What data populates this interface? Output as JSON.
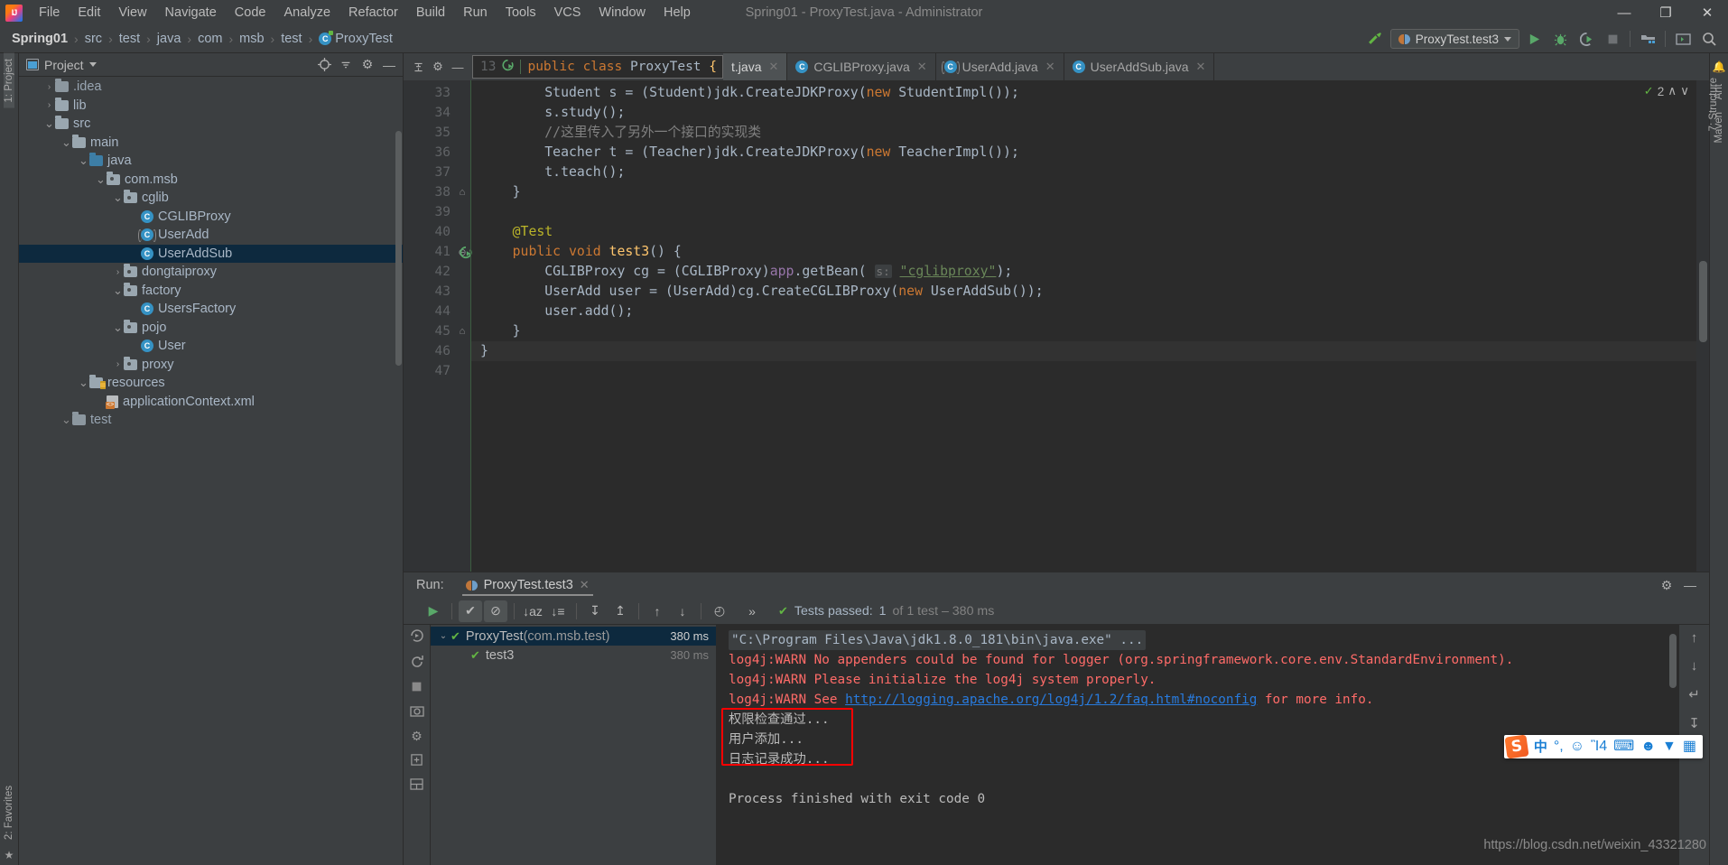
{
  "window": {
    "title": "Spring01 - ProxyTest.java - Administrator",
    "minimize": "—",
    "maximize": "❐",
    "close": "✕"
  },
  "menubar": [
    {
      "label": "File"
    },
    {
      "label": "Edit"
    },
    {
      "label": "View"
    },
    {
      "label": "Navigate"
    },
    {
      "label": "Code"
    },
    {
      "label": "Analyze"
    },
    {
      "label": "Refactor"
    },
    {
      "label": "Build"
    },
    {
      "label": "Run"
    },
    {
      "label": "Tools"
    },
    {
      "label": "VCS"
    },
    {
      "label": "Window"
    },
    {
      "label": "Help"
    }
  ],
  "breadcrumbs": [
    {
      "label": "Spring01",
      "bold": true
    },
    {
      "label": "src"
    },
    {
      "label": "test"
    },
    {
      "label": "java"
    },
    {
      "label": "com"
    },
    {
      "label": "msb"
    },
    {
      "label": "test"
    },
    {
      "label": "ProxyTest",
      "icon": "class-icon"
    }
  ],
  "breadcrumb_separator": "›",
  "toolbar": {
    "build_label": "build-hammer-icon",
    "run_config": "ProxyTest.test3",
    "run_label": "run-icon",
    "debug_label": "debug-icon",
    "coverage_label": "run-with-coverage-icon",
    "stop_label": "stop-icon",
    "project_structure_label": "project-structure-icon",
    "terminal_label": "terminal-icon",
    "search_label": "search-everywhere-icon"
  },
  "sidebar": {
    "title": "Project",
    "rail_left": [
      "1: Project",
      "2: Favorites"
    ],
    "rail_right": [
      "Ant",
      "Maven",
      "7: Structure"
    ],
    "tree": [
      {
        "label": ".idea",
        "depth": 1,
        "arrow": "›",
        "icon": "folder",
        "clipped": true
      },
      {
        "label": "lib",
        "depth": 1,
        "arrow": "›",
        "icon": "folder"
      },
      {
        "label": "src",
        "depth": 1,
        "arrow": "⌄",
        "icon": "folder"
      },
      {
        "label": "main",
        "depth": 2,
        "arrow": "⌄",
        "icon": "folder"
      },
      {
        "label": "java",
        "depth": 3,
        "arrow": "⌄",
        "icon": "folder-blue"
      },
      {
        "label": "com.msb",
        "depth": 4,
        "arrow": "⌄",
        "icon": "folder-package"
      },
      {
        "label": "cglib",
        "depth": 5,
        "arrow": "⌄",
        "icon": "folder-package"
      },
      {
        "label": "CGLIBProxy",
        "depth": 6,
        "arrow": "",
        "icon": "class-icon"
      },
      {
        "label": "UserAdd",
        "depth": 6,
        "arrow": "",
        "icon": "interface-icon"
      },
      {
        "label": "UserAddSub",
        "depth": 6,
        "arrow": "",
        "icon": "class-icon",
        "selected": true
      },
      {
        "label": "dongtaiproxy",
        "depth": 5,
        "arrow": "›",
        "icon": "folder-package"
      },
      {
        "label": "factory",
        "depth": 5,
        "arrow": "⌄",
        "icon": "folder-package"
      },
      {
        "label": "UsersFactory",
        "depth": 6,
        "arrow": "",
        "icon": "class-icon"
      },
      {
        "label": "pojo",
        "depth": 5,
        "arrow": "⌄",
        "icon": "folder-package"
      },
      {
        "label": "User",
        "depth": 6,
        "arrow": "",
        "icon": "class-icon"
      },
      {
        "label": "proxy",
        "depth": 5,
        "arrow": "›",
        "icon": "folder-package"
      },
      {
        "label": "resources",
        "depth": 3,
        "arrow": "⌄",
        "icon": "folder-resources"
      },
      {
        "label": "applicationContext.xml",
        "depth": 4,
        "arrow": "",
        "icon": "xml-icon"
      },
      {
        "label": "test",
        "depth": 2,
        "arrow": "⌄",
        "icon": "folder",
        "clipped": true
      }
    ]
  },
  "editor": {
    "tabs": [
      {
        "label": "t.java",
        "icon": "",
        "active": true,
        "close": "✕"
      },
      {
        "label": "CGLIBProxy.java",
        "icon": "class-icon",
        "active": false,
        "close": "✕"
      },
      {
        "label": "UserAdd.java",
        "icon": "interface-icon",
        "active": false,
        "close": "✕"
      },
      {
        "label": "UserAddSub.java",
        "icon": "class-icon",
        "active": false,
        "close": "✕"
      }
    ],
    "sticky_header": {
      "line": "13",
      "text": "public class ProxyTest {",
      "gutter_icon": "run-test-icon"
    },
    "inspection": {
      "count": "2",
      "up": "∧",
      "down": "∨"
    },
    "lines": [
      {
        "n": "33",
        "fold": "",
        "tokens": [
          {
            "t": "        Student s = (Student)jdk.CreateJDKProxy(",
            "c": "plain"
          },
          {
            "t": "new",
            "c": "kw"
          },
          {
            "t": " StudentImpl());",
            "c": "plain"
          }
        ]
      },
      {
        "n": "34",
        "fold": "",
        "tokens": [
          {
            "t": "        s.study();",
            "c": "plain"
          }
        ]
      },
      {
        "n": "35",
        "fold": "",
        "tokens": [
          {
            "t": "        //这里传入了另外一个接口的实现类",
            "c": "cmt"
          }
        ]
      },
      {
        "n": "36",
        "fold": "",
        "tokens": [
          {
            "t": "        Teacher t = (Teacher)jdk.CreateJDKProxy(",
            "c": "plain"
          },
          {
            "t": "new",
            "c": "kw"
          },
          {
            "t": " TeacherImpl());",
            "c": "plain"
          }
        ]
      },
      {
        "n": "37",
        "fold": "",
        "tokens": [
          {
            "t": "        t.teach();",
            "c": "plain"
          }
        ]
      },
      {
        "n": "38",
        "fold": "⌂",
        "tokens": [
          {
            "t": "    }",
            "c": "plain"
          }
        ]
      },
      {
        "n": "39",
        "fold": "",
        "tokens": [
          {
            "t": "",
            "c": "plain"
          }
        ]
      },
      {
        "n": "40",
        "fold": "",
        "tokens": [
          {
            "t": "    @Test",
            "c": "ann"
          }
        ]
      },
      {
        "n": "41",
        "fold": "⊖",
        "run": true,
        "tokens": [
          {
            "t": "    ",
            "c": "plain"
          },
          {
            "t": "public void",
            "c": "kw"
          },
          {
            "t": " ",
            "c": "plain"
          },
          {
            "t": "test3",
            "c": "mth"
          },
          {
            "t": "() {",
            "c": "plain"
          }
        ]
      },
      {
        "n": "42",
        "fold": "",
        "tokens": [
          {
            "t": "        CGLIBProxy cg = (CGLIBProxy)",
            "c": "plain"
          },
          {
            "t": "app",
            "c": "fld"
          },
          {
            "t": ".getBean( ",
            "c": "plain"
          },
          {
            "t": "s:",
            "c": "hint"
          },
          {
            "t": " ",
            "c": "plain"
          },
          {
            "t": "\"cglibproxy\"",
            "c": "str-under"
          },
          {
            "t": ");",
            "c": "plain"
          }
        ]
      },
      {
        "n": "43",
        "fold": "",
        "tokens": [
          {
            "t": "        UserAdd user = (UserAdd)cg.CreateCGLIBProxy(",
            "c": "plain"
          },
          {
            "t": "new",
            "c": "kw"
          },
          {
            "t": " UserAddSub());",
            "c": "plain"
          }
        ]
      },
      {
        "n": "44",
        "fold": "",
        "tokens": [
          {
            "t": "        user.add();",
            "c": "plain"
          }
        ]
      },
      {
        "n": "45",
        "fold": "⌂",
        "tokens": [
          {
            "t": "    }",
            "c": "plain"
          }
        ]
      },
      {
        "n": "46",
        "fold": "",
        "caret": true,
        "tokens": [
          {
            "t": "}",
            "c": "plain"
          }
        ]
      },
      {
        "n": "47",
        "fold": "",
        "tokens": [
          {
            "t": "",
            "c": "plain"
          }
        ]
      }
    ]
  },
  "run_panel": {
    "label": "Run:",
    "tab": "ProxyTest.test3",
    "tab_close": "✕",
    "settings_icon": "gear-icon",
    "hide_icon": "—",
    "toolbar": [
      {
        "name": "rerun-icon",
        "glyph": "▶"
      },
      {
        "name": "show-passed-icon",
        "glyph": "✔",
        "toggled": true
      },
      {
        "name": "hide-ignored-icon",
        "glyph": "⊘",
        "toggled": true
      },
      {
        "name": "sort-alphabetically-icon",
        "glyph": "↓aᴢ"
      },
      {
        "name": "sort-by-duration-icon",
        "glyph": "↓≡"
      },
      {
        "name": "expand-all-icon",
        "glyph": "↧"
      },
      {
        "name": "collapse-all-icon",
        "glyph": "↥"
      },
      {
        "name": "prev-failed-icon",
        "glyph": "↑"
      },
      {
        "name": "next-failed-icon",
        "glyph": "↓"
      },
      {
        "name": "test-history-icon",
        "glyph": "◴"
      }
    ],
    "overflow": "»",
    "status": {
      "check": "✔",
      "label": "Tests passed:",
      "count": "1",
      "detail": "of 1 test – 380 ms"
    },
    "tests": [
      {
        "name": "ProxyTest",
        "pkg": "(com.msb.test)",
        "duration": "380 ms",
        "depth": 0,
        "arrow": "⌄",
        "selected": true
      },
      {
        "name": "test3",
        "pkg": "",
        "duration": "380 ms",
        "depth": 1,
        "arrow": "",
        "selected": false
      }
    ],
    "console": [
      {
        "text": "\"C:\\Program Files\\Java\\jdk1.8.0_181\\bin\\java.exe\" ...",
        "style": "cmd"
      },
      {
        "text": "log4j:WARN No appenders could be found for logger (org.springframework.core.env.StandardEnvironment).",
        "style": "err"
      },
      {
        "text": "log4j:WARN Please initialize the log4j system properly.",
        "style": "err"
      },
      {
        "text": "log4j:WARN See ",
        "style": "err",
        "link": "http://logging.apache.org/log4j/1.2/faq.html#noconfig",
        "suffix": " for more info."
      },
      {
        "text": "权限检查通过...",
        "style": "out"
      },
      {
        "text": "用户添加...",
        "style": "out"
      },
      {
        "text": "日志记录成功...",
        "style": "out"
      },
      {
        "text": "",
        "style": "out"
      },
      {
        "text": "Process finished with exit code 0",
        "style": "out"
      }
    ],
    "console_rail": [
      {
        "name": "scroll-up-icon",
        "glyph": "↑"
      },
      {
        "name": "scroll-down-icon",
        "glyph": "↓"
      },
      {
        "name": "soft-wrap-icon",
        "glyph": "↵"
      },
      {
        "name": "scroll-to-end-icon",
        "glyph": "↧"
      },
      {
        "name": "print-icon",
        "glyph": "⎙"
      }
    ]
  },
  "ime": {
    "logo": "S",
    "items": [
      {
        "name": "chinese-mode-icon",
        "glyph": "中"
      },
      {
        "name": "punctuation-icon",
        "glyph": "°,"
      },
      {
        "name": "emoji-icon",
        "glyph": "☺"
      },
      {
        "name": "voice-input-icon",
        "glyph": "Ἲ4"
      },
      {
        "name": "keyboard-icon",
        "glyph": "⌨"
      },
      {
        "name": "user-icon",
        "glyph": "☻"
      },
      {
        "name": "skin-icon",
        "glyph": "▼"
      },
      {
        "name": "toolbox-icon",
        "glyph": "▦"
      }
    ]
  },
  "watermark": "https://blog.csdn.net/weixin_43321280"
}
